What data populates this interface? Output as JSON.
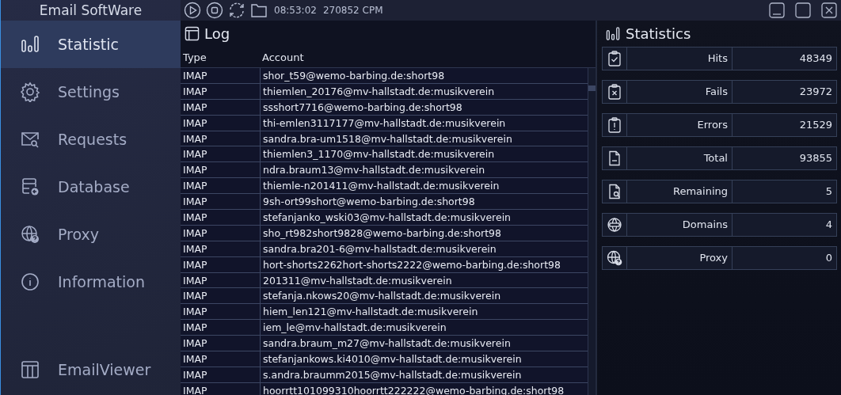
{
  "app": {
    "title": "Email SoftWare"
  },
  "toolbar": {
    "time": "08:53:02",
    "rate": "270852 CPM"
  },
  "sidebar": {
    "items": [
      {
        "label": "Statistic",
        "selected": true
      },
      {
        "label": "Settings",
        "selected": false
      },
      {
        "label": "Requests",
        "selected": false
      },
      {
        "label": "Database",
        "selected": false
      },
      {
        "label": "Proxy",
        "selected": false
      },
      {
        "label": "Information",
        "selected": false
      }
    ],
    "footer_item": {
      "label": "EmailViewer",
      "selected": false
    }
  },
  "log": {
    "title": "Log",
    "columns": [
      "Type",
      "Account"
    ],
    "rows": [
      [
        "IMAP",
        "shor_t59@wemo-barbing.de:short98"
      ],
      [
        "IMAP",
        "thiemlen_20176@mv-hallstadt.de:musikverein"
      ],
      [
        "IMAP",
        "ssshort7716@wemo-barbing.de:short98"
      ],
      [
        "IMAP",
        "thi-emlen3117177@mv-hallstadt.de:musikverein"
      ],
      [
        "IMAP",
        "sandra.bra-um1518@mv-hallstadt.de:musikverein"
      ],
      [
        "IMAP",
        "thiemlen3_1170@mv-hallstadt.de:musikverein"
      ],
      [
        "IMAP",
        "ndra.braum13@mv-hallstadt.de:musikverein"
      ],
      [
        "IMAP",
        "thiemle-n201411@mv-hallstadt.de:musikverein"
      ],
      [
        "IMAP",
        "9sh-ort99short@wemo-barbing.de:short98"
      ],
      [
        "IMAP",
        "stefanjanko_wski03@mv-hallstadt.de:musikverein"
      ],
      [
        "IMAP",
        "sho_rt982short9828@wemo-barbing.de:short98"
      ],
      [
        "IMAP",
        "sandra.bra201-6@mv-hallstadt.de:musikverein"
      ],
      [
        "IMAP",
        "hort-shorts2262hort-shorts2222@wemo-barbing.de:short98"
      ],
      [
        "IMAP",
        "201311@mv-hallstadt.de:musikverein"
      ],
      [
        "IMAP",
        "stefanja.nkows20@mv-hallstadt.de:musikverein"
      ],
      [
        "IMAP",
        "hiem_len121@mv-hallstadt.de:musikverein"
      ],
      [
        "IMAP",
        "iem_le@mv-hallstadt.de:musikverein"
      ],
      [
        "IMAP",
        "sandra.braum_m27@mv-hallstadt.de:musikverein"
      ],
      [
        "IMAP",
        "stefanjankows.ki4010@mv-hallstadt.de:musikverein"
      ],
      [
        "IMAP",
        "s.andra.braumm2015@mv-hallstadt.de:musikverein"
      ],
      [
        "IMAP",
        "hoorrtt101099310hoorrtt222222@wemo-barbing.de:short98"
      ]
    ]
  },
  "statistics": {
    "title": "Statistics",
    "rows": [
      {
        "label": "Hits",
        "value": "48349"
      },
      {
        "label": "Fails",
        "value": "23972"
      },
      {
        "label": "Errors",
        "value": "21529"
      },
      {
        "label": "Total",
        "value": "93855"
      },
      {
        "label": "Remaining",
        "value": "5"
      },
      {
        "label": "Domains",
        "value": "4"
      },
      {
        "label": "Proxy",
        "value": "0"
      }
    ]
  }
}
